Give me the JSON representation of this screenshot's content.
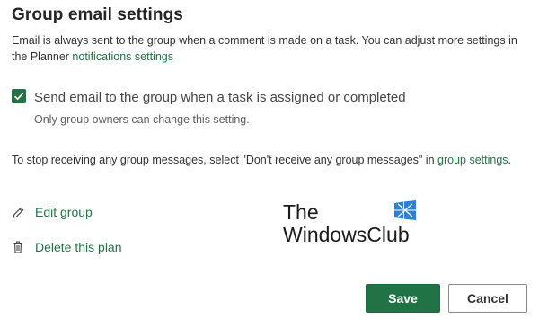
{
  "dialog": {
    "title": "Group email settings",
    "description_text": "Email is always sent to the group when a comment is made on a task. You can adjust more settings in the Planner ",
    "notifications_link": "notifications settings"
  },
  "checkbox": {
    "checked": true,
    "label": "Send email to the group when a task is assigned or completed",
    "note": "Only group owners can change this setting."
  },
  "stop_messages": {
    "text": "To stop receiving any group messages, select \"Don't receive any group messages\" in ",
    "link": "group settings",
    "suffix": "."
  },
  "actions": {
    "edit_group": {
      "label": "Edit group",
      "icon": "pencil-icon"
    },
    "delete_plan": {
      "label": "Delete this plan",
      "icon": "trash-icon"
    }
  },
  "watermark": {
    "line1": "The",
    "line2": "WindowsClub"
  },
  "buttons": {
    "save": "Save",
    "cancel": "Cancel"
  },
  "colors": {
    "accent": "#217346",
    "logo": "#2b7fd4"
  }
}
